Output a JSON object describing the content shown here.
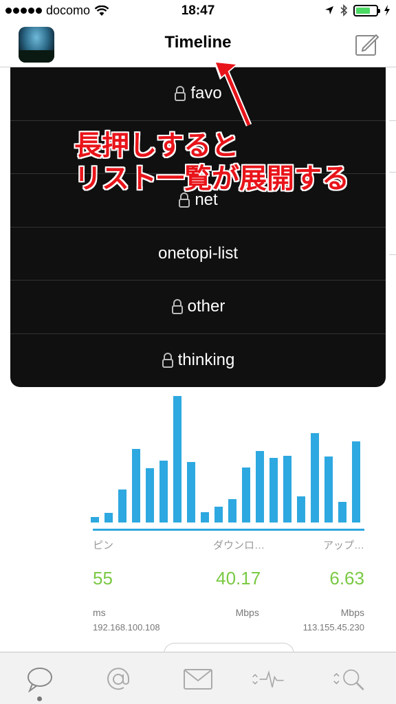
{
  "status_bar": {
    "carrier": "docomo",
    "time": "18:47"
  },
  "nav": {
    "title": "Timeline"
  },
  "list_menu": {
    "items": [
      {
        "label": "favo",
        "locked": true
      },
      {
        "label": "",
        "locked": false
      },
      {
        "label": "net",
        "locked": true
      },
      {
        "label": "onetopi-list",
        "locked": false
      },
      {
        "label": "other",
        "locked": true
      },
      {
        "label": "thinking",
        "locked": true
      }
    ]
  },
  "annotation": {
    "line1": "長押しすると",
    "line2": "リスト一覧が展開する"
  },
  "speedtest": {
    "labels": {
      "ping": "ピン",
      "download": "ダウンロ…",
      "upload": "アップ…"
    },
    "values": {
      "ping": "55",
      "download": "40.17",
      "upload": "6.63"
    },
    "units": {
      "ping": "ms",
      "download": "Mbps",
      "upload": "Mbps"
    },
    "local_ip": "192.168.100.108",
    "remote_ip": "113.155.45.230"
  },
  "chart_data": {
    "type": "bar",
    "values": [
      8,
      14,
      48,
      107,
      79,
      90,
      184,
      88,
      15,
      23,
      34,
      80,
      104,
      94,
      97,
      38,
      130,
      96,
      30,
      118
    ],
    "ylim": [
      0,
      190
    ],
    "color": "#2ea8e0"
  },
  "tab_bar": {
    "tabs": [
      "speech-bubble-icon",
      "at-sign-icon",
      "mail-icon",
      "activity-icon",
      "search-icon"
    ],
    "active": 0
  },
  "colors": {
    "accent": "#2ea8e0",
    "value_green": "#7ac943",
    "annotation_red": "#e8141a",
    "menu_bg": "#101010"
  }
}
